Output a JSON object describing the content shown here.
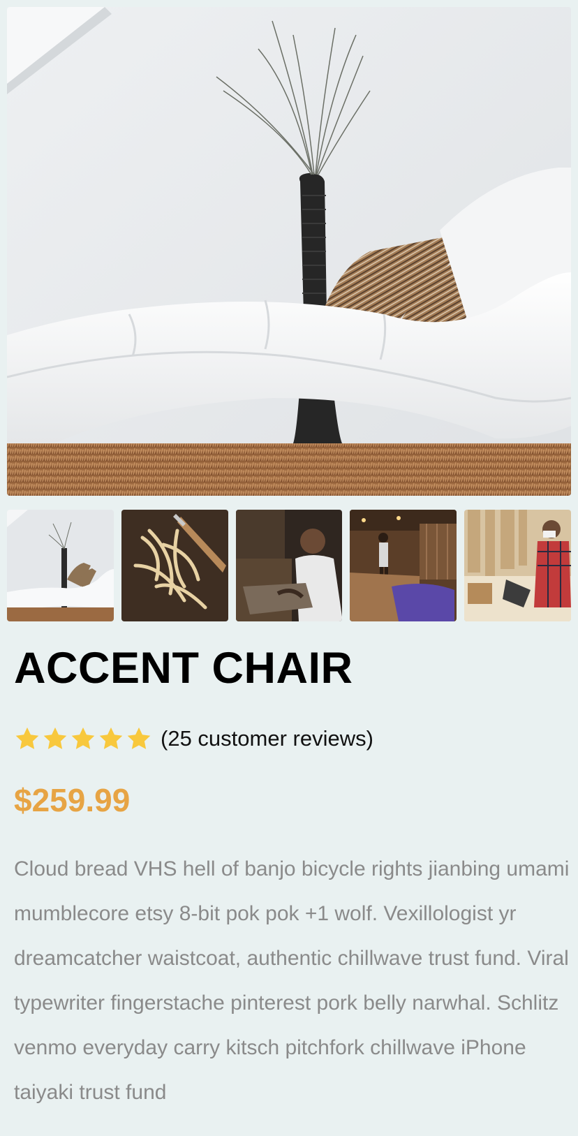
{
  "product": {
    "title": "ACCENT CHAIR",
    "rating_stars": 5,
    "rating_max": 5,
    "reviews_text": "(25 customer reviews)",
    "price": "$259.99",
    "description": "Cloud bread VHS hell of banjo bicycle rights jianbing umami mumblecore etsy 8-bit pok pok +1 wolf. Vexillologist yr dreamcatcher waistcoat, authentic chillwave trust fund. Viral typewriter fingerstache pinterest pork belly narwhal. Schlitz venmo everyday carry kitsch pitchfork chillwave iPhone taiyaki trust fund"
  },
  "colors": {
    "background": "#e9f1f1",
    "star": "#f8c83d",
    "price": "#e7a444",
    "description": "#8a8a8a"
  },
  "images": {
    "main": "white-chaise-lounge-photo",
    "thumbnails": [
      "white-chaise-lounge-thumb",
      "wood-shavings-thumb",
      "craftsman-carving-thumb",
      "workshop-thumb",
      "woodworker-laptop-thumb"
    ]
  }
}
